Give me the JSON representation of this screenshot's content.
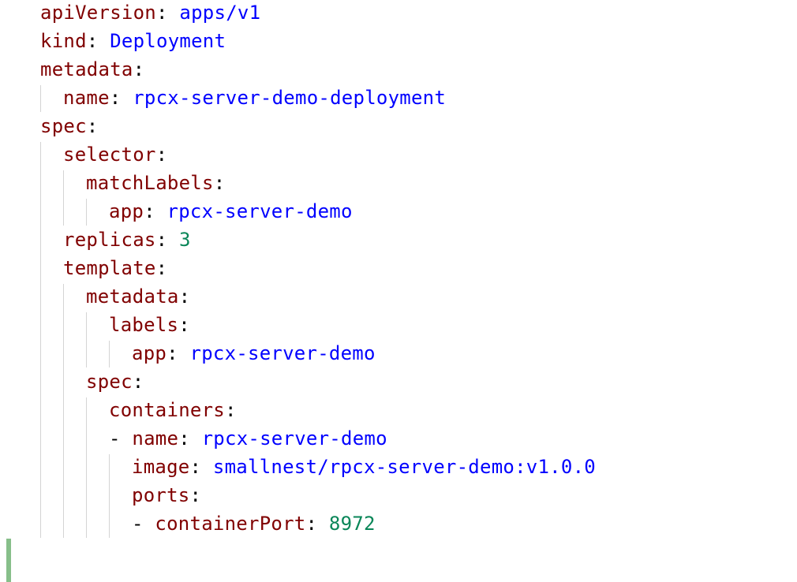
{
  "editor": {
    "colors": {
      "key": "#800000",
      "string": "#0000ff",
      "number": "#098658",
      "guide": "#d4d4d4",
      "gutter_marker": "#87bf8a"
    },
    "lines": [
      {
        "indent": 0,
        "dash": "",
        "key": "apiVersion",
        "value": "apps/v1",
        "vtype": "str"
      },
      {
        "indent": 0,
        "dash": "",
        "key": "kind",
        "value": "Deployment",
        "vtype": "str"
      },
      {
        "indent": 0,
        "dash": "",
        "key": "metadata",
        "value": "",
        "vtype": ""
      },
      {
        "indent": 1,
        "dash": "",
        "key": "name",
        "value": "rpcx-server-demo-deployment",
        "vtype": "str"
      },
      {
        "indent": 0,
        "dash": "",
        "key": "spec",
        "value": "",
        "vtype": ""
      },
      {
        "indent": 1,
        "dash": "",
        "key": "selector",
        "value": "",
        "vtype": ""
      },
      {
        "indent": 2,
        "dash": "",
        "key": "matchLabels",
        "value": "",
        "vtype": ""
      },
      {
        "indent": 3,
        "dash": "",
        "key": "app",
        "value": "rpcx-server-demo",
        "vtype": "str"
      },
      {
        "indent": 1,
        "dash": "",
        "key": "replicas",
        "value": "3",
        "vtype": "num"
      },
      {
        "indent": 1,
        "dash": "",
        "key": "template",
        "value": "",
        "vtype": ""
      },
      {
        "indent": 2,
        "dash": "",
        "key": "metadata",
        "value": "",
        "vtype": ""
      },
      {
        "indent": 3,
        "dash": "",
        "key": "labels",
        "value": "",
        "vtype": ""
      },
      {
        "indent": 4,
        "dash": "",
        "key": "app",
        "value": "rpcx-server-demo",
        "vtype": "str"
      },
      {
        "indent": 2,
        "dash": "",
        "key": "spec",
        "value": "",
        "vtype": ""
      },
      {
        "indent": 3,
        "dash": "",
        "key": "containers",
        "value": "",
        "vtype": ""
      },
      {
        "indent": 3,
        "dash": "- ",
        "key": "name",
        "value": "rpcx-server-demo",
        "vtype": "str"
      },
      {
        "indent": 4,
        "dash": "",
        "key": "image",
        "value": "smallnest/rpcx-server-demo:v1.0.0",
        "vtype": "str"
      },
      {
        "indent": 4,
        "dash": "",
        "key": "ports",
        "value": "",
        "vtype": ""
      },
      {
        "indent": 4,
        "dash": "- ",
        "key": "containerPort",
        "value": "8972",
        "vtype": "num"
      }
    ]
  }
}
